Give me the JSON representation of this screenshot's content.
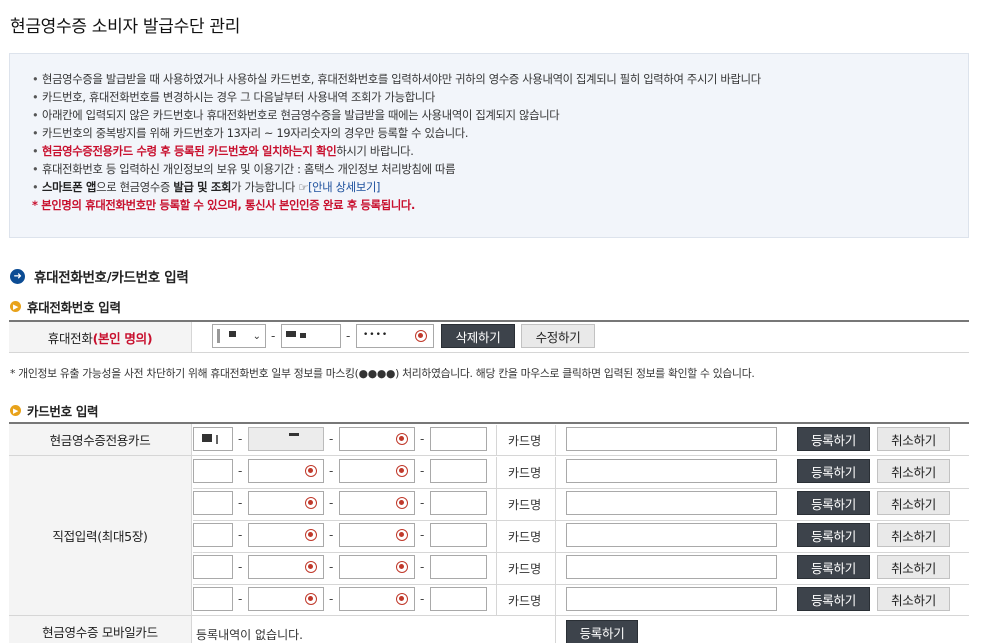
{
  "page": {
    "title": "현금영수증 소비자 발급수단 관리"
  },
  "notice": {
    "items": [
      {
        "parts": [
          {
            "t": "현금영수증을 발급받을 때 사용하였거나 사용하실 카드번호, 휴대전화번호를 입력하셔야만 귀하의 영수증 사용내역이 집계되니 필히 입력하여 주시기 바랍니다",
            "s": ""
          }
        ]
      },
      {
        "parts": [
          {
            "t": "카드번호, 휴대전화번호를 변경하시는 경우 그 다음날부터 사용내역 조회가 가능합니다",
            "s": ""
          }
        ]
      },
      {
        "parts": [
          {
            "t": "아래칸에 입력되지 않은 카드번호나 휴대전화번호로 현금영수증을 발급받을 때에는 사용내역이 집계되지 않습니다",
            "s": ""
          }
        ]
      },
      {
        "parts": [
          {
            "t": "카드번호의 중복방지를 위해 카드번호가 13자리 ~ 19자리숫자의 경우만 등록할 수 있습니다.",
            "s": ""
          }
        ]
      },
      {
        "parts": [
          {
            "t": "현금영수증전용카드 수령 후 등록된 카드번호와 일치하는지 확인",
            "s": "red"
          },
          {
            "t": "하시기 바랍니다.",
            "s": ""
          }
        ]
      },
      {
        "parts": [
          {
            "t": "휴대전화번호 등 입력하신 개인정보의 보유 및 이용기간 : 홈택스 개인정보 처리방침에 따름",
            "s": ""
          }
        ]
      },
      {
        "parts": [
          {
            "t": "스마트폰 앱",
            "s": "b"
          },
          {
            "t": "으로 현금영수증 ",
            "s": ""
          },
          {
            "t": "발급 및 조회",
            "s": "b"
          },
          {
            "t": "가 가능합니다 ",
            "s": ""
          },
          {
            "t": "☞",
            "s": ""
          },
          {
            "t": "[안내 상세보기]",
            "s": "link"
          }
        ]
      },
      {
        "parts": [
          {
            "t": "* 본인명의 휴대전화번호만 등록할 수 있으며, 통신사 본인인증 완료 후 등록됩니다.",
            "s": "red"
          }
        ]
      }
    ]
  },
  "section": {
    "title": "휴대전화번호/카드번호 입력",
    "phone_sub": "휴대전화번호 입력",
    "phone_label": "휴대전화",
    "phone_label_red": "(본인 명의)",
    "phone_masked_last": "••••",
    "phone_delete": "삭제하기",
    "phone_edit": "수정하기",
    "privacy_note": "* 개인정보 유출 가능성을 사전 차단하기 위해 휴대전화번호 일부 정보를 마스킹(●●●●) 처리하였습니다. 해당 칸을 마우스로 클릭하면 입력된 정보를 확인할 수 있습니다.",
    "card_sub": "카드번호 입력",
    "row_dedicated": "현금영수증전용카드",
    "row_direct": "직접입력(최대5장)",
    "row_mobile": "현금영수증 모바일카드",
    "card_name_label": "카드명",
    "register": "등록하기",
    "cancel": "취소하기",
    "no_history": "등록내역이 없습니다.",
    "mobile_register": "등록하기"
  },
  "colors": {
    "accent_red": "#c8102e",
    "dark_button": "#3d434b",
    "section_icon": "#0c4c94",
    "sub_icon": "#e8a21a"
  }
}
